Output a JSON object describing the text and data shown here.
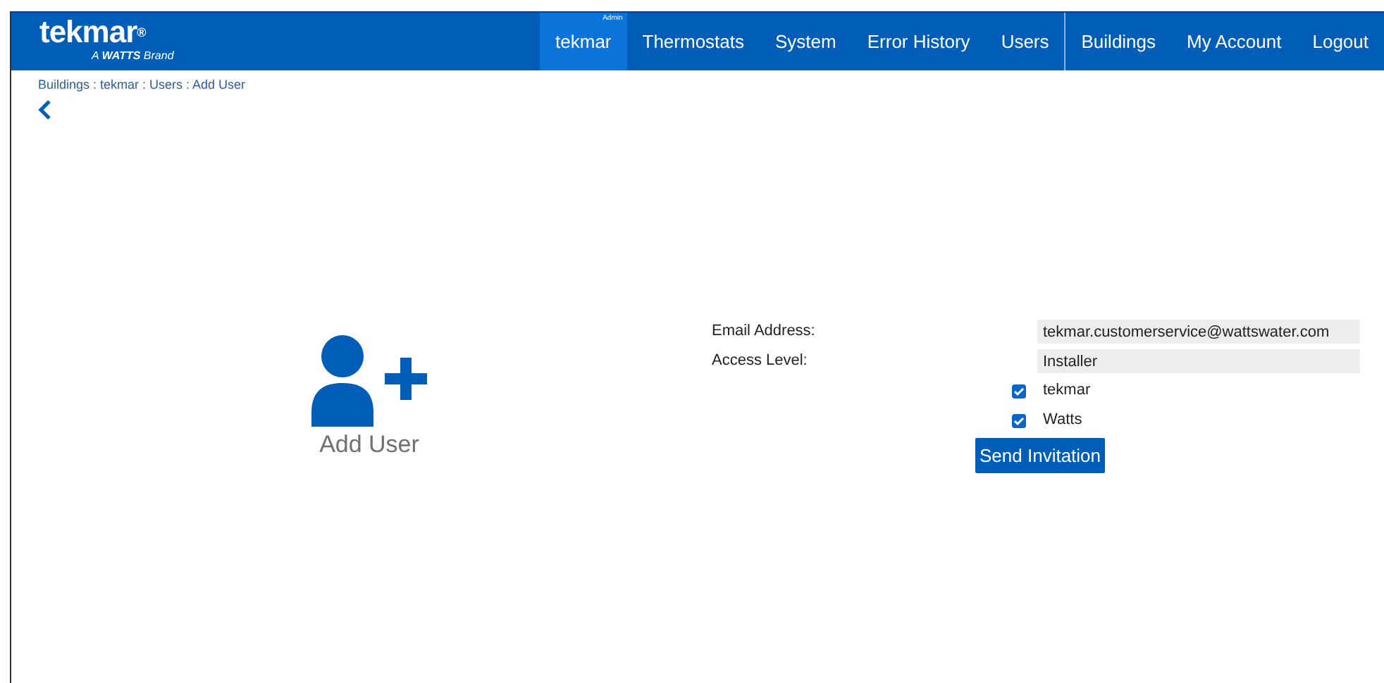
{
  "header": {
    "logo": "tekmar",
    "logo_mark": "®",
    "tagline_prefix": "A",
    "tagline_brand": "WATTS",
    "tagline_suffix": "Brand"
  },
  "nav": [
    {
      "label": "tekmar",
      "badge": "Admin",
      "selected": true
    },
    {
      "label": "Thermostats",
      "selected": false
    },
    {
      "label": "System",
      "selected": false
    },
    {
      "label": "Error History",
      "selected": false
    },
    {
      "label": "Users",
      "selected": false,
      "divider_after": true
    },
    {
      "label": "Buildings",
      "selected": false
    },
    {
      "label": "My Account",
      "selected": false
    },
    {
      "label": "Logout",
      "selected": false
    }
  ],
  "breadcrumb": "Buildings : tekmar : Users : Add User",
  "page_title": "Add User",
  "form": {
    "fields": [
      {
        "label": "Email Address:",
        "value": "tekmar.customerservice@wattswater.com"
      },
      {
        "label": "Access Level:",
        "value": "Installer"
      }
    ],
    "checkboxes": [
      {
        "label": "tekmar",
        "checked": true
      },
      {
        "label": "Watts",
        "checked": true
      }
    ],
    "submit": "Send Invitation"
  }
}
